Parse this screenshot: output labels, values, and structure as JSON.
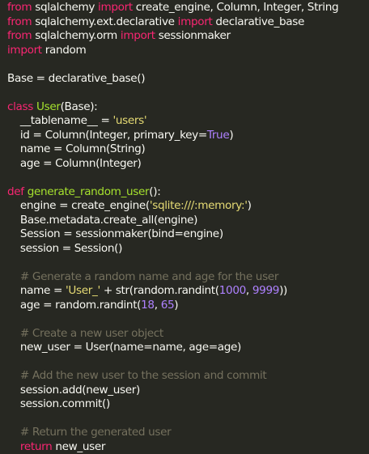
{
  "editor": {
    "language": "python",
    "theme_colors": {
      "background": "#272822",
      "text": "#f8f8f2",
      "keyword": "#f92672",
      "function": "#a6e22e",
      "string": "#e6db74",
      "number": "#ae81ff",
      "comment": "#75715e"
    },
    "lines": [
      [
        [
          "kw",
          "from"
        ],
        [
          "p",
          " sqlalchemy "
        ],
        [
          "kw",
          "import"
        ],
        [
          "p",
          " create_engine, Column, Integer, String"
        ]
      ],
      [
        [
          "kw",
          "from"
        ],
        [
          "p",
          " sqlalchemy.ext.declarative "
        ],
        [
          "kw",
          "import"
        ],
        [
          "p",
          " declarative_base"
        ]
      ],
      [
        [
          "kw",
          "from"
        ],
        [
          "p",
          " sqlalchemy.orm "
        ],
        [
          "kw",
          "import"
        ],
        [
          "p",
          " sessionmaker"
        ]
      ],
      [
        [
          "kw",
          "import"
        ],
        [
          "p",
          " random"
        ]
      ],
      [],
      [
        [
          "p",
          "Base = declarative_base()"
        ]
      ],
      [],
      [
        [
          "kw",
          "class"
        ],
        [
          "p",
          " "
        ],
        [
          "fn",
          "User"
        ],
        [
          "p",
          "(Base):"
        ]
      ],
      [
        [
          "p",
          "    __tablename__ = "
        ],
        [
          "str",
          "'users'"
        ]
      ],
      [
        [
          "p",
          "    id = Column(Integer, primary_key="
        ],
        [
          "num",
          "True"
        ],
        [
          "p",
          ")"
        ]
      ],
      [
        [
          "p",
          "    name = Column(String)"
        ]
      ],
      [
        [
          "p",
          "    age = Column(Integer)"
        ]
      ],
      [],
      [
        [
          "kw",
          "def"
        ],
        [
          "p",
          " "
        ],
        [
          "fn",
          "generate_random_user"
        ],
        [
          "p",
          "():"
        ]
      ],
      [
        [
          "p",
          "    engine = create_engine("
        ],
        [
          "str",
          "'sqlite:///:memory:'"
        ],
        [
          "p",
          ")"
        ]
      ],
      [
        [
          "p",
          "    Base.metadata.create_all(engine)"
        ]
      ],
      [
        [
          "p",
          "    Session = sessionmaker(bind=engine)"
        ]
      ],
      [
        [
          "p",
          "    session = Session()"
        ]
      ],
      [],
      [
        [
          "cm",
          "    # Generate a random name and age for the user"
        ]
      ],
      [
        [
          "p",
          "    name = "
        ],
        [
          "str",
          "'User_'"
        ],
        [
          "p",
          " + str(random.randint("
        ],
        [
          "num",
          "1000"
        ],
        [
          "p",
          ", "
        ],
        [
          "num",
          "9999"
        ],
        [
          "p",
          "))"
        ]
      ],
      [
        [
          "p",
          "    age = random.randint("
        ],
        [
          "num",
          "18"
        ],
        [
          "p",
          ", "
        ],
        [
          "num",
          "65"
        ],
        [
          "p",
          ")"
        ]
      ],
      [],
      [
        [
          "cm",
          "    # Create a new user object"
        ]
      ],
      [
        [
          "p",
          "    new_user = User(name=name, age=age)"
        ]
      ],
      [],
      [
        [
          "cm",
          "    # Add the new user to the session and commit"
        ]
      ],
      [
        [
          "p",
          "    session.add(new_user)"
        ]
      ],
      [
        [
          "p",
          "    session.commit()"
        ]
      ],
      [],
      [
        [
          "cm",
          "    # Return the generated user"
        ]
      ],
      [
        [
          "kw",
          "    return"
        ],
        [
          "p",
          " new_user"
        ]
      ]
    ]
  }
}
